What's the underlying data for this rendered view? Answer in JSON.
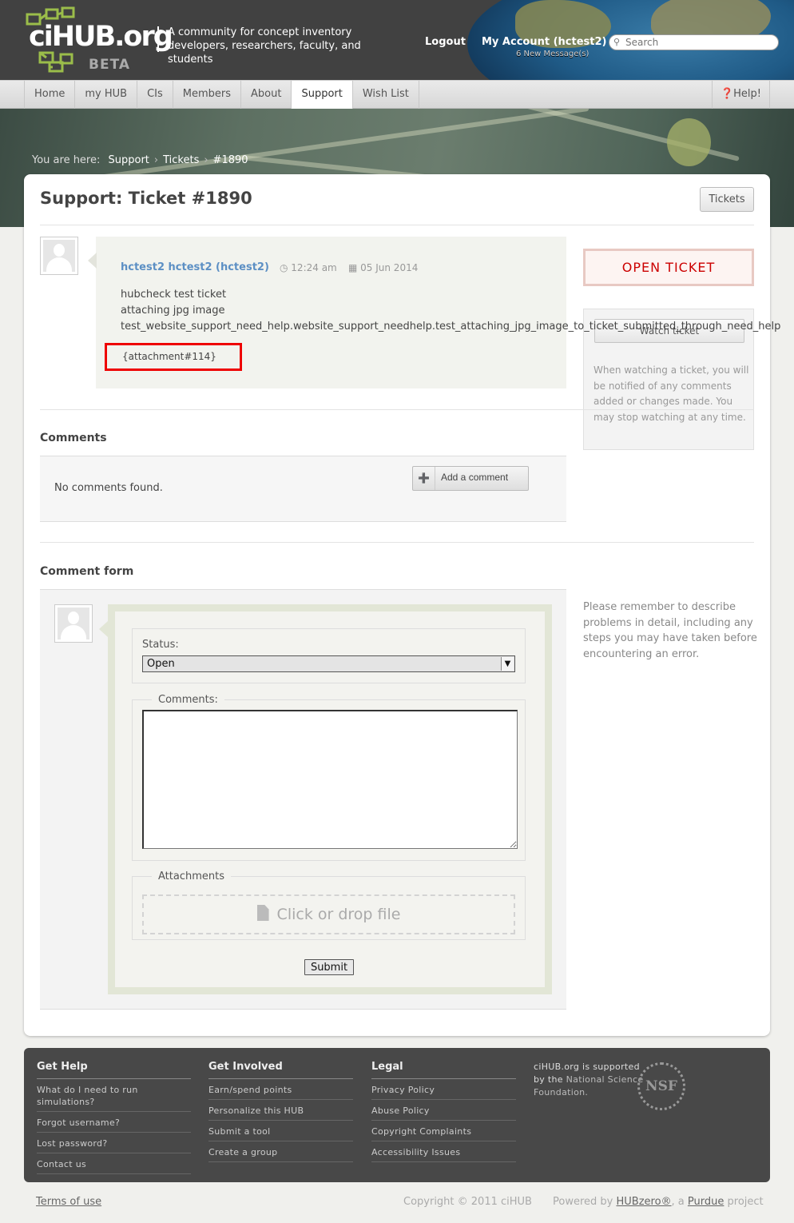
{
  "header": {
    "logo_text": "ciHUB.org",
    "logo_badge": "BETA",
    "tagline": "A community for concept inventory developers, researchers, faculty, and students",
    "logout": "Logout",
    "account": "My Account (hctest2)",
    "messages": "6 New Message(s)",
    "search_placeholder": "Search"
  },
  "nav": {
    "items": [
      "Home",
      "my HUB",
      "CIs",
      "Members",
      "About",
      "Support",
      "Wish List"
    ],
    "active": "Support",
    "help": "Help!"
  },
  "breadcrumb": {
    "prefix": "You are here:",
    "items": [
      "Support",
      "Tickets",
      "#1890"
    ]
  },
  "ticket": {
    "title": "Support: Ticket #1890",
    "tickets_button": "Tickets",
    "author": "hctest2 hctest2 (hctest2)",
    "time": "12:24 am",
    "date": "05 Jun 2014",
    "lines": [
      "hubcheck test ticket",
      "attaching jpg image",
      "test_website_support_need_help.website_support_needhelp.test_attaching_jpg_image_to_ticket_submitted_through_need_help"
    ],
    "attachment": "{attachment#114}",
    "status_label": "OPEN TICKET",
    "watch_button": "Watch ticket",
    "watch_text": "When watching a ticket, you will be notified of any comments added or changes made. You may stop watching at any time."
  },
  "comments": {
    "heading": "Comments",
    "empty": "No comments found.",
    "add_button": "Add a comment"
  },
  "form": {
    "heading": "Comment form",
    "status_label": "Status:",
    "status_value": "Open",
    "comments_legend": "Comments:",
    "attachments_legend": "Attachments",
    "dropzone": "Click or drop file",
    "submit": "Submit",
    "note": "Please remember to describe problems in detail, including any steps you may have taken before encountering an error."
  },
  "footer": {
    "get_help": {
      "title": "Get Help",
      "links": [
        "What do I need to run simulations?",
        "Forgot username?",
        "Lost password?",
        "Contact us"
      ]
    },
    "get_involved": {
      "title": "Get Involved",
      "links": [
        "Earn/spend points",
        "Personalize this HUB",
        "Submit a tool",
        "Create a group"
      ]
    },
    "legal": {
      "title": "Legal",
      "links": [
        "Privacy Policy",
        "Abuse Policy",
        "Copyright Complaints",
        "Accessibility Issues"
      ]
    },
    "supported_prefix": "ciHUB.org is supported by the",
    "supported_org": "National Science Foundation.",
    "seal": "NSF"
  },
  "bottom": {
    "terms": "Terms of use",
    "copyright": "Copyright © 2011 ciHUB",
    "powered_prefix": "Powered by",
    "hubzero": "HUBzero®",
    "powered_mid": ", a",
    "purdue": "Purdue",
    "powered_suffix": "project"
  }
}
